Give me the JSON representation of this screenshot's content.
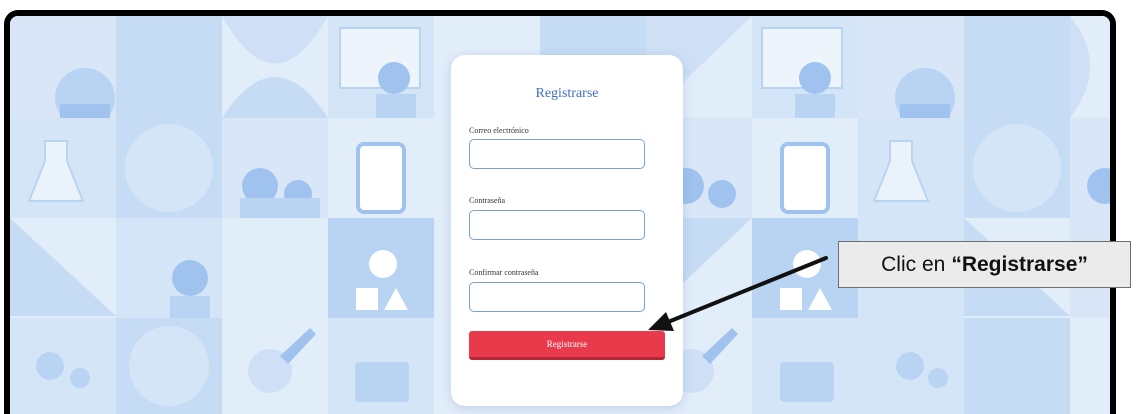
{
  "form": {
    "title": "Registrarse",
    "email_label": "Correo electrónico",
    "email_value": "",
    "password_label": "Contraseña",
    "password_value": "",
    "confirm_label": "Confirmar contraseña",
    "confirm_value": "",
    "submit_label": "Registrarse"
  },
  "callout": {
    "prefix": "Clic en",
    "emphasis": "“Registrarse”"
  },
  "colors": {
    "background": "#e2edfa",
    "tile_dark": "#b9d4f3",
    "tile_mid": "#cfe0f6",
    "title_blue": "#3d6fc7",
    "button_red": "#e93a4b",
    "arrow": "#111111"
  }
}
